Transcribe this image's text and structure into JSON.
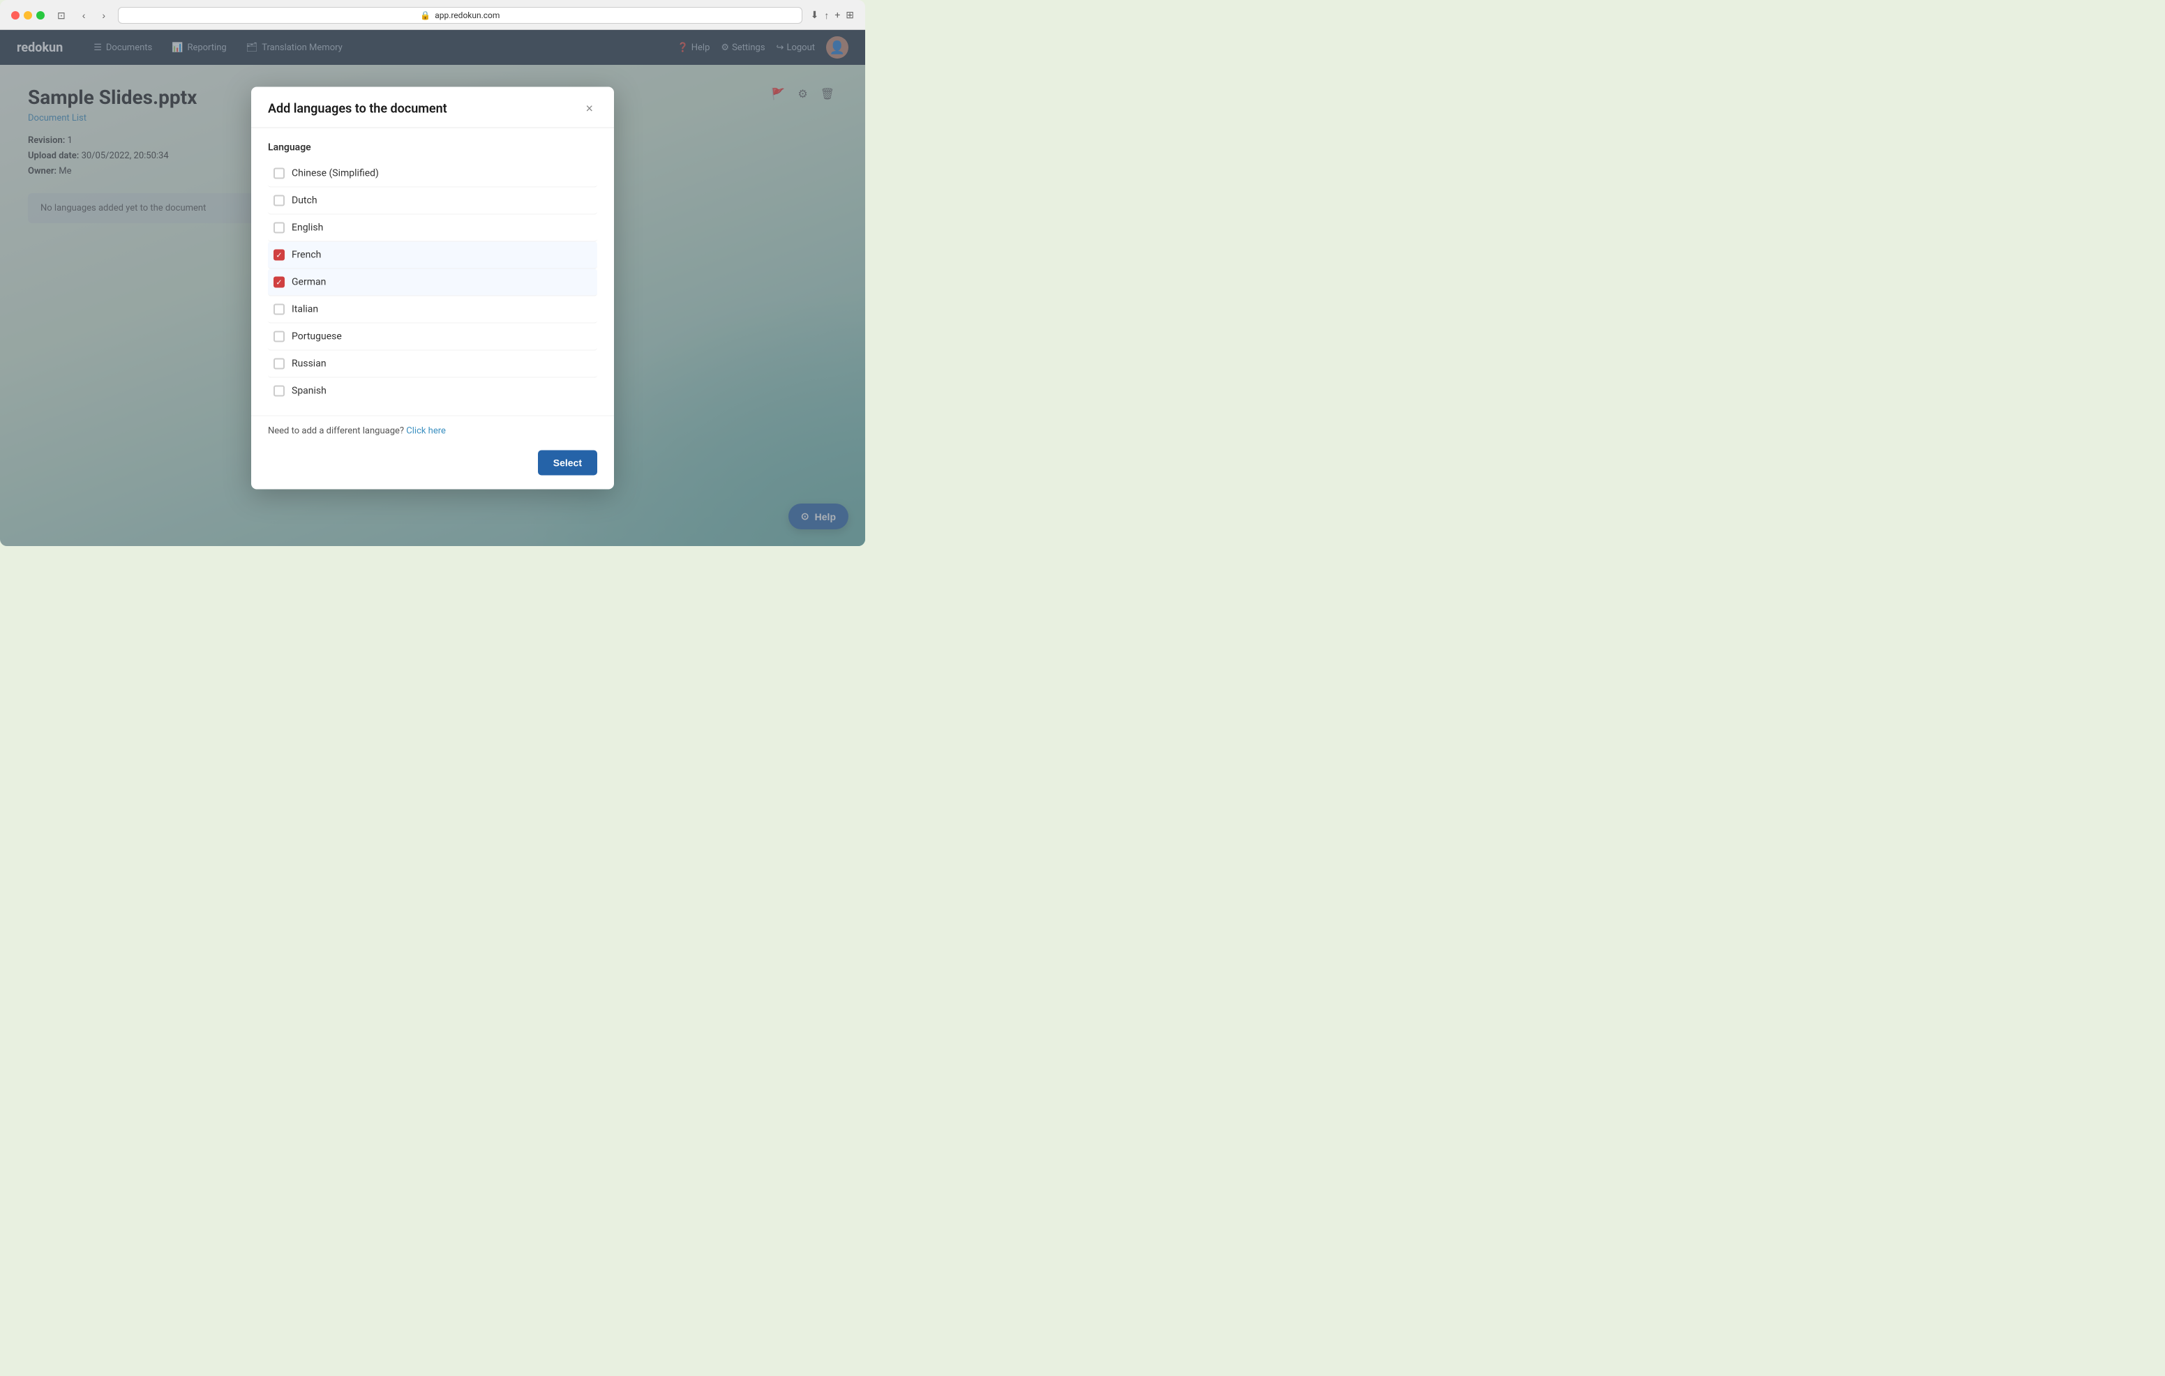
{
  "browser": {
    "url": "app.redokun.com"
  },
  "navbar": {
    "brand": "redokun",
    "nav_items": [
      {
        "id": "documents",
        "label": "Documents",
        "icon": "☰"
      },
      {
        "id": "reporting",
        "label": "Reporting",
        "icon": "📊"
      },
      {
        "id": "translation_memory",
        "label": "Translation Memory",
        "icon": "🗂"
      }
    ],
    "right_items": [
      {
        "id": "help",
        "label": "Help",
        "icon": "?"
      },
      {
        "id": "settings",
        "label": "Settings",
        "icon": "⚙"
      },
      {
        "id": "logout",
        "label": "Logout",
        "icon": "↪"
      }
    ]
  },
  "document": {
    "title": "Sample Slides.pptx",
    "breadcrumb": "Document List",
    "revision_label": "Revision:",
    "revision_value": "1",
    "upload_date_label": "Upload date:",
    "upload_date_value": "30/05/2022, 20:50:34",
    "owner_label": "Owner:",
    "owner_value": "Me",
    "no_languages_text": "No languages added yet to the document"
  },
  "modal": {
    "title": "Add languages to the document",
    "close_label": "×",
    "lang_column_header": "Language",
    "languages": [
      {
        "id": "chinese_simplified",
        "label": "Chinese (Simplified)",
        "checked": false
      },
      {
        "id": "dutch",
        "label": "Dutch",
        "checked": false
      },
      {
        "id": "english",
        "label": "English",
        "checked": false
      },
      {
        "id": "french",
        "label": "French",
        "checked": true
      },
      {
        "id": "german",
        "label": "German",
        "checked": true
      },
      {
        "id": "italian",
        "label": "Italian",
        "checked": false
      },
      {
        "id": "portuguese",
        "label": "Portuguese",
        "checked": false
      },
      {
        "id": "russian",
        "label": "Russian",
        "checked": false
      },
      {
        "id": "spanish",
        "label": "Spanish",
        "checked": false
      }
    ],
    "footer_note": "Need to add a different language?",
    "footer_link": "Click here",
    "select_button": "Select"
  },
  "help_button": {
    "label": "Help",
    "icon": "⊙"
  }
}
